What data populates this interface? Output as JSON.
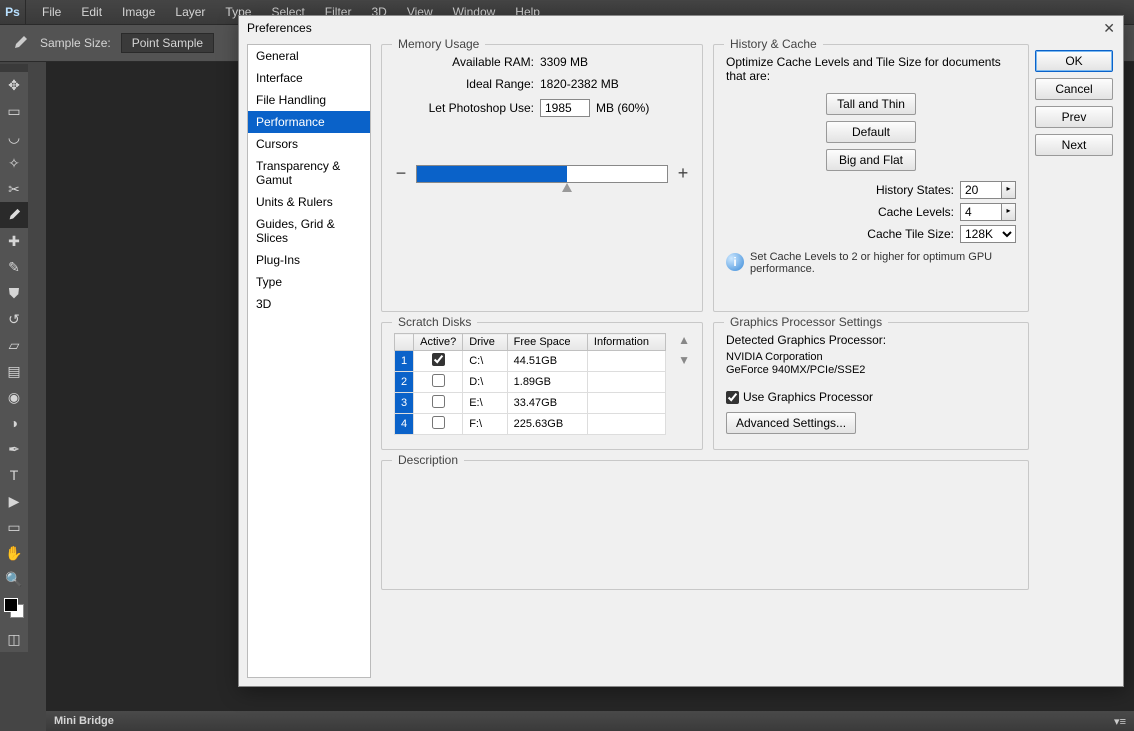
{
  "app": {
    "logo": "Ps"
  },
  "menubar": [
    "File",
    "Edit",
    "Image",
    "Layer",
    "Type",
    "Select",
    "Filter",
    "3D",
    "View",
    "Window",
    "Help"
  ],
  "optionbar": {
    "sample_size_label": "Sample Size:",
    "sample_size_value": "Point Sample"
  },
  "minibridge": {
    "title": "Mini Bridge"
  },
  "dialog": {
    "title": "Preferences",
    "categories": [
      "General",
      "Interface",
      "File Handling",
      "Performance",
      "Cursors",
      "Transparency & Gamut",
      "Units & Rulers",
      "Guides, Grid & Slices",
      "Plug-Ins",
      "Type",
      "3D"
    ],
    "selected_category": "Performance",
    "actions": {
      "ok": "OK",
      "cancel": "Cancel",
      "prev": "Prev",
      "next": "Next"
    },
    "memory": {
      "legend": "Memory Usage",
      "available_label": "Available RAM:",
      "available_value": "3309 MB",
      "ideal_label": "Ideal Range:",
      "ideal_value": "1820-2382 MB",
      "let_use_label": "Let Photoshop Use:",
      "let_use_value": "1985",
      "let_use_suffix": "MB (60%)",
      "minus": "−",
      "plus": "+"
    },
    "history_cache": {
      "legend": "History & Cache",
      "intro": "Optimize Cache Levels and Tile Size for documents that are:",
      "btn_tall": "Tall and Thin",
      "btn_default": "Default",
      "btn_big": "Big and Flat",
      "history_states_label": "History States:",
      "history_states_value": "20",
      "cache_levels_label": "Cache Levels:",
      "cache_levels_value": "4",
      "cache_tile_label": "Cache Tile Size:",
      "cache_tile_value": "128K",
      "info": "Set Cache Levels to 2 or higher for optimum GPU performance."
    },
    "scratch": {
      "legend": "Scratch Disks",
      "headers": {
        "active": "Active?",
        "drive": "Drive",
        "free": "Free Space",
        "info": "Information"
      },
      "rows": [
        {
          "n": "1",
          "active": true,
          "drive": "C:\\",
          "free": "44.51GB",
          "info": ""
        },
        {
          "n": "2",
          "active": false,
          "drive": "D:\\",
          "free": "1.89GB",
          "info": ""
        },
        {
          "n": "3",
          "active": false,
          "drive": "E:\\",
          "free": "33.47GB",
          "info": ""
        },
        {
          "n": "4",
          "active": false,
          "drive": "F:\\",
          "free": "225.63GB",
          "info": ""
        }
      ]
    },
    "gpu": {
      "legend": "Graphics Processor Settings",
      "detected_label": "Detected Graphics Processor:",
      "vendor": "NVIDIA Corporation",
      "model": "GeForce 940MX/PCIe/SSE2",
      "use_gpu_label": "Use Graphics Processor",
      "use_gpu_checked": true,
      "advanced_btn": "Advanced Settings..."
    },
    "description": {
      "legend": "Description"
    }
  }
}
